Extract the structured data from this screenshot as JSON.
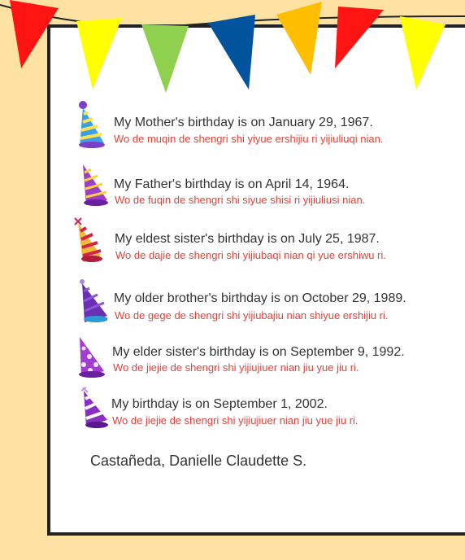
{
  "entries": [
    {
      "english": "My Mother's birthday is on January 29, 1967.",
      "pinyin": "Wo de muqin de shengri shi yiyue ershijiu ri yijiuliuqi nian.",
      "hat_icon": "party-hat-icon-blue-stripes"
    },
    {
      "english": "My Father's birthday is on April 14, 1964.",
      "pinyin": "Wo de fuqin de shengri shi siyue shisi ri yijiuliusi nian.",
      "hat_icon": "party-hat-icon-purple-stripes"
    },
    {
      "english": "My eldest sister's birthday is on July 25, 1987.",
      "pinyin": "Wo de dajie de shengri shi yijiubaqi nian qi yue ershiwu ri.",
      "hat_icon": "party-hat-icon-gold-red"
    },
    {
      "english": "My older brother's birthday is on October 29, 1989.",
      "pinyin": "Wo de gege de shengri shi yijiubajiu nian shiyue ershijiu ri.",
      "hat_icon": "party-hat-icon-purple-blue"
    },
    {
      "english": "My elder sister's birthday is on September 9, 1992.",
      "pinyin": "Wo de jiejie de shengri shi yijiujiuer nian jiu yue jiu ri.",
      "hat_icon": "party-hat-icon-purple-dots"
    },
    {
      "english": "My birthday is on September 1, 2002.",
      "pinyin": "Wo de jiejie de shengri shi yijiujiuer nian jiu yue jiu ri.",
      "hat_icon": "party-hat-icon-purple-white"
    }
  ],
  "signature": "Castañeda, Danielle Claudette S.",
  "colors": {
    "background": "#fde2a4",
    "english_text": "#333333",
    "pinyin_text": "#e0433a",
    "flags": [
      "#ff1414",
      "#ffff00",
      "#8fd14f",
      "#00539c",
      "#ffbf00",
      "#ff1414",
      "#ffff00"
    ]
  }
}
